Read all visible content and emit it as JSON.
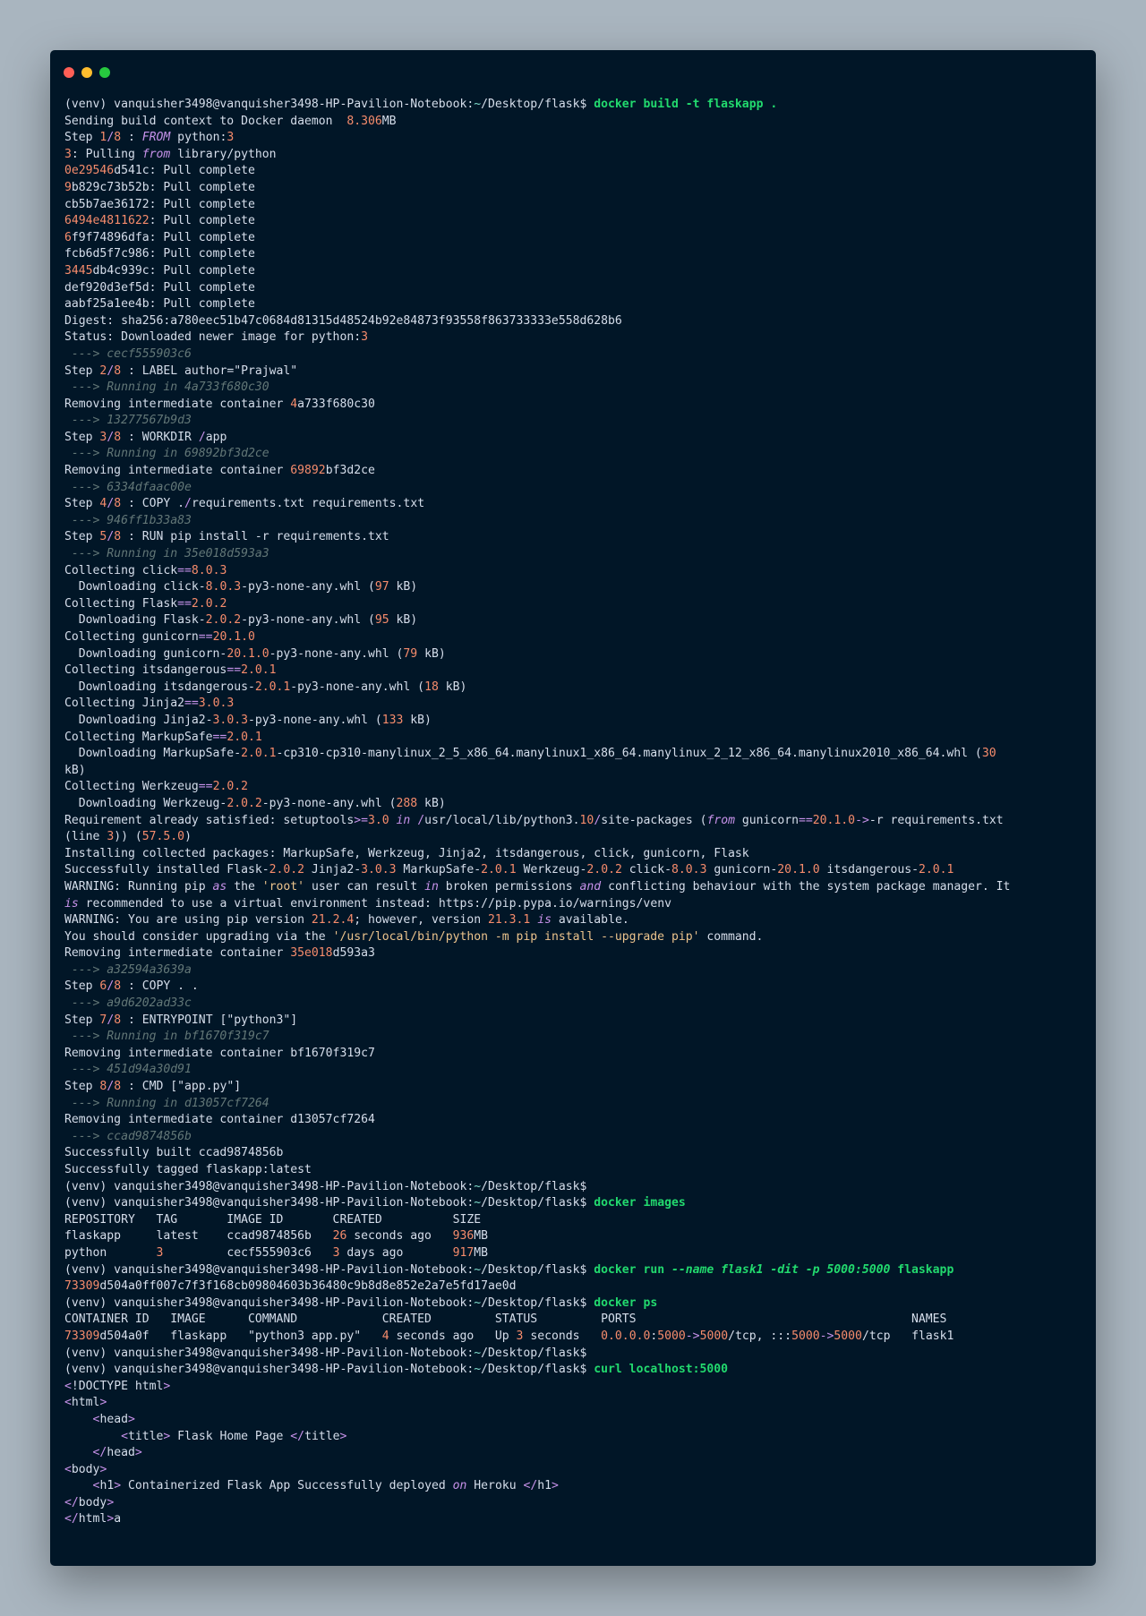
{
  "window": {
    "buttons": [
      "close",
      "minimize",
      "maximize"
    ]
  },
  "colors": {
    "background": "#011627",
    "text": "#d6deeb",
    "command": "#22da6e",
    "number": "#f78c6c",
    "keyword": "#c792ea",
    "comment": "#637777",
    "string": "#ecc48d"
  },
  "lines": [
    [
      [
        "p",
        "(venv) vanquisher3498@vanquisher3498-HP-Pavilion-Notebook:"
      ],
      [
        "cy",
        "~"
      ],
      [
        "p",
        "/Desktop/flask$ "
      ],
      [
        "c",
        "docker build -t flaskapp ."
      ]
    ],
    [
      [
        "p",
        "Sending build context to Docker daemon  "
      ],
      [
        "n",
        "8.306"
      ],
      [
        "p",
        "MB"
      ]
    ],
    [
      [
        "p",
        "Step "
      ],
      [
        "n",
        "1"
      ],
      [
        "o",
        "/"
      ],
      [
        "n",
        "8"
      ],
      [
        "p",
        " : "
      ],
      [
        "k",
        "FROM"
      ],
      [
        "p",
        " python:"
      ],
      [
        "n",
        "3"
      ]
    ],
    [
      [
        "n",
        "3"
      ],
      [
        "p",
        ": Pulling "
      ],
      [
        "k",
        "from"
      ],
      [
        "p",
        " library/python"
      ]
    ],
    [
      [
        "n",
        "0e29546"
      ],
      [
        "p",
        "d541c: Pull complete"
      ]
    ],
    [
      [
        "n",
        "9"
      ],
      [
        "p",
        "b829c73b52b: Pull complete"
      ]
    ],
    [
      [
        "p",
        "cb5b7ae36172: Pull complete"
      ]
    ],
    [
      [
        "n",
        "6494e4811622"
      ],
      [
        "p",
        ": Pull complete"
      ]
    ],
    [
      [
        "n",
        "6"
      ],
      [
        "p",
        "f9f74896dfa: Pull complete"
      ]
    ],
    [
      [
        "p",
        "fcb6d5f7c986: Pull complete"
      ]
    ],
    [
      [
        "n",
        "3445"
      ],
      [
        "p",
        "db4c939c: Pull complete"
      ]
    ],
    [
      [
        "p",
        "def920d3ef5d: Pull complete"
      ]
    ],
    [
      [
        "p",
        "aabf25a1ee4b: Pull complete"
      ]
    ],
    [
      [
        "p",
        "Digest: sha256:a780eec51b47c0684d81315d48524b92e84873f93558f863733333e558d628b6"
      ]
    ],
    [
      [
        "p",
        "Status: Downloaded newer image for python:"
      ],
      [
        "n",
        "3"
      ]
    ],
    [
      [
        "dim",
        " ---> cecf555903c6"
      ]
    ],
    [
      [
        "p",
        "Step "
      ],
      [
        "n",
        "2"
      ],
      [
        "o",
        "/"
      ],
      [
        "n",
        "8"
      ],
      [
        "p",
        " : LABEL author="
      ],
      [
        "p",
        "\"Prajwal\""
      ]
    ],
    [
      [
        "dim",
        " ---> Running in 4a733f680c30"
      ]
    ],
    [
      [
        "p",
        "Removing intermediate container "
      ],
      [
        "n",
        "4"
      ],
      [
        "p",
        "a733f680c30"
      ]
    ],
    [
      [
        "dim",
        " ---> 13277567b9d3"
      ]
    ],
    [
      [
        "p",
        "Step "
      ],
      [
        "n",
        "3"
      ],
      [
        "o",
        "/"
      ],
      [
        "n",
        "8"
      ],
      [
        "p",
        " : WORKDIR "
      ],
      [
        "o",
        "/"
      ],
      [
        "p",
        "app"
      ]
    ],
    [
      [
        "dim",
        " ---> Running in 69892bf3d2ce"
      ]
    ],
    [
      [
        "p",
        "Removing intermediate container "
      ],
      [
        "n",
        "69892"
      ],
      [
        "p",
        "bf3d2ce"
      ]
    ],
    [
      [
        "dim",
        " ---> 6334dfaac00e"
      ]
    ],
    [
      [
        "p",
        "Step "
      ],
      [
        "n",
        "4"
      ],
      [
        "o",
        "/"
      ],
      [
        "n",
        "8"
      ],
      [
        "p",
        " : COPY ."
      ],
      [
        "o",
        "/"
      ],
      [
        "p",
        "requirements.txt requirements.txt"
      ]
    ],
    [
      [
        "dim",
        " ---> 946ff1b33a83"
      ]
    ],
    [
      [
        "p",
        "Step "
      ],
      [
        "n",
        "5"
      ],
      [
        "o",
        "/"
      ],
      [
        "n",
        "8"
      ],
      [
        "p",
        " : RUN pip install -r requirements.txt"
      ]
    ],
    [
      [
        "dim",
        " ---> Running in 35e018d593a3"
      ]
    ],
    [
      [
        "p",
        "Collecting click"
      ],
      [
        "o",
        "=="
      ],
      [
        "n",
        "8.0.3"
      ]
    ],
    [
      [
        "p",
        "  Downloading click-"
      ],
      [
        "n",
        "8.0.3"
      ],
      [
        "p",
        "-py3-none-any.whl ("
      ],
      [
        "n",
        "97"
      ],
      [
        "p",
        " kB)"
      ]
    ],
    [
      [
        "p",
        "Collecting Flask"
      ],
      [
        "o",
        "=="
      ],
      [
        "n",
        "2.0.2"
      ]
    ],
    [
      [
        "p",
        "  Downloading Flask-"
      ],
      [
        "n",
        "2.0.2"
      ],
      [
        "p",
        "-py3-none-any.whl ("
      ],
      [
        "n",
        "95"
      ],
      [
        "p",
        " kB)"
      ]
    ],
    [
      [
        "p",
        "Collecting gunicorn"
      ],
      [
        "o",
        "=="
      ],
      [
        "n",
        "20.1.0"
      ]
    ],
    [
      [
        "p",
        "  Downloading gunicorn-"
      ],
      [
        "n",
        "20.1.0"
      ],
      [
        "p",
        "-py3-none-any.whl ("
      ],
      [
        "n",
        "79"
      ],
      [
        "p",
        " kB)"
      ]
    ],
    [
      [
        "p",
        "Collecting itsdangerous"
      ],
      [
        "o",
        "=="
      ],
      [
        "n",
        "2.0.1"
      ]
    ],
    [
      [
        "p",
        "  Downloading itsdangerous-"
      ],
      [
        "n",
        "2.0.1"
      ],
      [
        "p",
        "-py3-none-any.whl ("
      ],
      [
        "n",
        "18"
      ],
      [
        "p",
        " kB)"
      ]
    ],
    [
      [
        "p",
        "Collecting Jinja2"
      ],
      [
        "o",
        "=="
      ],
      [
        "n",
        "3.0.3"
      ]
    ],
    [
      [
        "p",
        "  Downloading Jinja2-"
      ],
      [
        "n",
        "3.0.3"
      ],
      [
        "p",
        "-py3-none-any.whl ("
      ],
      [
        "n",
        "133"
      ],
      [
        "p",
        " kB)"
      ]
    ],
    [
      [
        "p",
        "Collecting MarkupSafe"
      ],
      [
        "o",
        "=="
      ],
      [
        "n",
        "2.0.1"
      ]
    ],
    [
      [
        "p",
        "  Downloading MarkupSafe-"
      ],
      [
        "n",
        "2.0.1"
      ],
      [
        "p",
        "-cp310-cp310-manylinux_2_5_x86_64.manylinux1_x86_64.manylinux_2_12_x86_64.manylinux2010_x86_64.whl ("
      ],
      [
        "n",
        "30"
      ]
    ],
    [
      [
        "p",
        "kB)"
      ]
    ],
    [
      [
        "p",
        "Collecting Werkzeug"
      ],
      [
        "o",
        "=="
      ],
      [
        "n",
        "2.0.2"
      ]
    ],
    [
      [
        "p",
        "  Downloading Werkzeug-"
      ],
      [
        "n",
        "2.0.2"
      ],
      [
        "p",
        "-py3-none-any.whl ("
      ],
      [
        "n",
        "288"
      ],
      [
        "p",
        " kB)"
      ]
    ],
    [
      [
        "p",
        "Requirement already satisfied: setuptools"
      ],
      [
        "o",
        ">="
      ],
      [
        "n",
        "3.0"
      ],
      [
        "p",
        " "
      ],
      [
        "k",
        "in"
      ],
      [
        "p",
        " "
      ],
      [
        "o",
        "/"
      ],
      [
        "p",
        "usr/local/lib/python3."
      ],
      [
        "n",
        "10"
      ],
      [
        "o",
        "/"
      ],
      [
        "p",
        "site-packages ("
      ],
      [
        "k",
        "from"
      ],
      [
        "p",
        " gunicorn"
      ],
      [
        "o",
        "=="
      ],
      [
        "n",
        "20.1.0"
      ],
      [
        "o",
        "->"
      ],
      [
        "p",
        "-r requirements.txt"
      ]
    ],
    [
      [
        "p",
        "(line "
      ],
      [
        "n",
        "3"
      ],
      [
        "p",
        ")) ("
      ],
      [
        "n",
        "57.5.0"
      ],
      [
        "p",
        ")"
      ]
    ],
    [
      [
        "p",
        "Installing collected packages: MarkupSafe, Werkzeug, Jinja2, itsdangerous, click, gunicorn, Flask"
      ]
    ],
    [
      [
        "p",
        "Successfully installed Flask-"
      ],
      [
        "n",
        "2.0.2"
      ],
      [
        "p",
        " Jinja2-"
      ],
      [
        "n",
        "3.0.3"
      ],
      [
        "p",
        " MarkupSafe-"
      ],
      [
        "n",
        "2.0.1"
      ],
      [
        "p",
        " Werkzeug-"
      ],
      [
        "n",
        "2.0.2"
      ],
      [
        "p",
        " click-"
      ],
      [
        "n",
        "8.0.3"
      ],
      [
        "p",
        " gunicorn-"
      ],
      [
        "n",
        "20.1.0"
      ],
      [
        "p",
        " itsdangerous-"
      ],
      [
        "n",
        "2.0.1"
      ]
    ],
    [
      [
        "p",
        "WARNING: Running pip "
      ],
      [
        "k",
        "as"
      ],
      [
        "p",
        " the "
      ],
      [
        "str",
        "'root'"
      ],
      [
        "p",
        " user can result "
      ],
      [
        "k",
        "in"
      ],
      [
        "p",
        " broken permissions "
      ],
      [
        "k",
        "and"
      ],
      [
        "p",
        " conflicting behaviour with the system package manager. It"
      ]
    ],
    [
      [
        "k",
        "is"
      ],
      [
        "p",
        " recommended to use a virtual environment instead: https://pip.pypa.io/warnings/venv"
      ]
    ],
    [
      [
        "p",
        "WARNING: You are using pip version "
      ],
      [
        "n",
        "21.2.4"
      ],
      [
        "p",
        "; however, version "
      ],
      [
        "n",
        "21.3.1"
      ],
      [
        "p",
        " "
      ],
      [
        "k",
        "is"
      ],
      [
        "p",
        " available."
      ]
    ],
    [
      [
        "p",
        "You should consider upgrading via the "
      ],
      [
        "str",
        "'/usr/local/bin/python -m pip install --upgrade pip'"
      ],
      [
        "p",
        " command."
      ]
    ],
    [
      [
        "p",
        "Removing intermediate container "
      ],
      [
        "n",
        "35e018"
      ],
      [
        "p",
        "d593a3"
      ]
    ],
    [
      [
        "dim",
        " ---> a32594a3639a"
      ]
    ],
    [
      [
        "p",
        "Step "
      ],
      [
        "n",
        "6"
      ],
      [
        "o",
        "/"
      ],
      [
        "n",
        "8"
      ],
      [
        "p",
        " : COPY . ."
      ]
    ],
    [
      [
        "dim",
        " ---> a9d6202ad33c"
      ]
    ],
    [
      [
        "p",
        "Step "
      ],
      [
        "n",
        "7"
      ],
      [
        "o",
        "/"
      ],
      [
        "n",
        "8"
      ],
      [
        "p",
        " : ENTRYPOINT [\"python3\"]"
      ]
    ],
    [
      [
        "dim",
        " ---> Running in bf1670f319c7"
      ]
    ],
    [
      [
        "p",
        "Removing intermediate container bf1670f319c7"
      ]
    ],
    [
      [
        "dim",
        " ---> 451d94a30d91"
      ]
    ],
    [
      [
        "p",
        "Step "
      ],
      [
        "n",
        "8"
      ],
      [
        "o",
        "/"
      ],
      [
        "n",
        "8"
      ],
      [
        "p",
        " : CMD [\"app.py\"]"
      ]
    ],
    [
      [
        "dim",
        " ---> Running in d13057cf7264"
      ]
    ],
    [
      [
        "p",
        "Removing intermediate container d13057cf7264"
      ]
    ],
    [
      [
        "dim",
        " ---> ccad9874856b"
      ]
    ],
    [
      [
        "p",
        "Successfully built ccad9874856b"
      ]
    ],
    [
      [
        "p",
        "Successfully tagged flaskapp:latest"
      ]
    ],
    [
      [
        "p",
        "(venv) vanquisher3498@vanquisher3498-HP-Pavilion-Notebook:"
      ],
      [
        "cy",
        "~"
      ],
      [
        "p",
        "/Desktop/flask$"
      ]
    ],
    [
      [
        "p",
        "(venv) vanquisher3498@vanquisher3498-HP-Pavilion-Notebook:"
      ],
      [
        "cy",
        "~"
      ],
      [
        "p",
        "/Desktop/flask$ "
      ],
      [
        "c",
        "docker images"
      ]
    ],
    [
      [
        "p",
        "REPOSITORY   TAG       IMAGE ID       CREATED          SIZE"
      ]
    ],
    [
      [
        "p",
        "flaskapp     latest    ccad9874856b   "
      ],
      [
        "n",
        "26"
      ],
      [
        "p",
        " seconds ago   "
      ],
      [
        "n",
        "936"
      ],
      [
        "p",
        "MB"
      ]
    ],
    [
      [
        "p",
        "python       "
      ],
      [
        "n",
        "3"
      ],
      [
        "p",
        "         cecf555903c6   "
      ],
      [
        "n",
        "3"
      ],
      [
        "p",
        " days ago       "
      ],
      [
        "n",
        "917"
      ],
      [
        "p",
        "MB"
      ]
    ],
    [
      [
        "p",
        "(venv) vanquisher3498@vanquisher3498-HP-Pavilion-Notebook:"
      ],
      [
        "cy",
        "~"
      ],
      [
        "p",
        "/Desktop/flask$ "
      ],
      [
        "c",
        "docker run "
      ],
      [
        "ci",
        "--name flask1 -dit -p 5000:5000"
      ],
      [
        "c",
        " flaskapp"
      ]
    ],
    [
      [
        "n",
        "73309"
      ],
      [
        "p",
        "d504a0ff007c7f3f168cb09804603b36480c9b8d8e852e2a7e5fd17ae0d"
      ]
    ],
    [
      [
        "p",
        "(venv) vanquisher3498@vanquisher3498-HP-Pavilion-Notebook:"
      ],
      [
        "cy",
        "~"
      ],
      [
        "p",
        "/Desktop/flask$ "
      ],
      [
        "c",
        "docker ps"
      ]
    ],
    [
      [
        "p",
        "CONTAINER ID   IMAGE      COMMAND            CREATED         STATUS         PORTS                                       NAMES"
      ]
    ],
    [
      [
        "n",
        "73309"
      ],
      [
        "p",
        "d504a0f   flaskapp   \"python3 app.py\"   "
      ],
      [
        "n",
        "4"
      ],
      [
        "p",
        " seconds ago   Up "
      ],
      [
        "n",
        "3"
      ],
      [
        "p",
        " seconds   "
      ],
      [
        "n",
        "0.0.0.0"
      ],
      [
        "p",
        ":"
      ],
      [
        "n",
        "5000"
      ],
      [
        "o",
        "->"
      ],
      [
        "n",
        "5000"
      ],
      [
        "p",
        "/tcp, :::"
      ],
      [
        "n",
        "5000"
      ],
      [
        "o",
        "->"
      ],
      [
        "n",
        "5000"
      ],
      [
        "p",
        "/tcp   flask1"
      ]
    ],
    [
      [
        "p",
        "(venv) vanquisher3498@vanquisher3498-HP-Pavilion-Notebook:"
      ],
      [
        "cy",
        "~"
      ],
      [
        "p",
        "/Desktop/flask$"
      ]
    ],
    [
      [
        "p",
        "(venv) vanquisher3498@vanquisher3498-HP-Pavilion-Notebook:"
      ],
      [
        "cy",
        "~"
      ],
      [
        "p",
        "/Desktop/flask$ "
      ],
      [
        "c",
        "curl localhost:5000"
      ]
    ],
    [
      [
        "o",
        "<"
      ],
      [
        "p",
        "!DOCTYPE html"
      ],
      [
        "o",
        ">"
      ]
    ],
    [
      [
        "o",
        "<"
      ],
      [
        "p",
        "html"
      ],
      [
        "o",
        ">"
      ]
    ],
    [
      [
        "p",
        "    "
      ],
      [
        "o",
        "<"
      ],
      [
        "p",
        "head"
      ],
      [
        "o",
        ">"
      ]
    ],
    [
      [
        "p",
        "        "
      ],
      [
        "o",
        "<"
      ],
      [
        "p",
        "title"
      ],
      [
        "o",
        ">"
      ],
      [
        "p",
        " Flask Home Page "
      ],
      [
        "o",
        "</"
      ],
      [
        "p",
        "title"
      ],
      [
        "o",
        ">"
      ]
    ],
    [
      [
        "p",
        "    "
      ],
      [
        "o",
        "</"
      ],
      [
        "p",
        "head"
      ],
      [
        "o",
        ">"
      ]
    ],
    [
      [
        "o",
        "<"
      ],
      [
        "p",
        "body"
      ],
      [
        "o",
        ">"
      ]
    ],
    [
      [
        "p",
        "    "
      ],
      [
        "o",
        "<"
      ],
      [
        "p",
        "h1"
      ],
      [
        "o",
        ">"
      ],
      [
        "p",
        " Containerized Flask App Successfully deployed "
      ],
      [
        "k",
        "on"
      ],
      [
        "p",
        " Heroku "
      ],
      [
        "o",
        "</"
      ],
      [
        "p",
        "h1"
      ],
      [
        "o",
        ">"
      ]
    ],
    [
      [
        "o",
        "</"
      ],
      [
        "p",
        "body"
      ],
      [
        "o",
        ">"
      ]
    ],
    [
      [
        "o",
        "</"
      ],
      [
        "p",
        "html"
      ],
      [
        "o",
        ">"
      ],
      [
        "p",
        "a"
      ]
    ]
  ]
}
